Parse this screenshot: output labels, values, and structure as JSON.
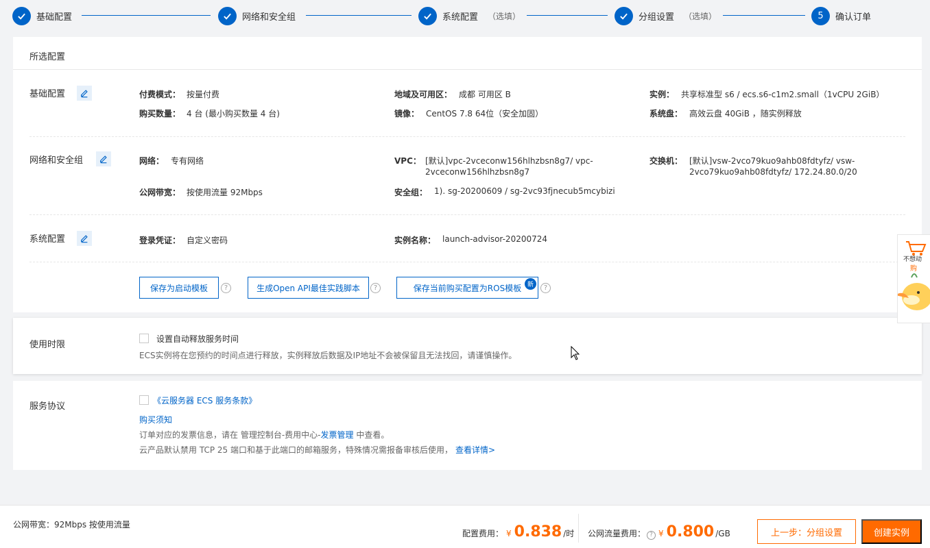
{
  "steps": [
    {
      "label": "基础配置",
      "optional": "",
      "done": true
    },
    {
      "label": "网络和安全组",
      "optional": "",
      "done": true
    },
    {
      "label": "系统配置",
      "optional": "（选填）",
      "done": true
    },
    {
      "label": "分组设置",
      "optional": "（选填）",
      "done": true
    },
    {
      "label": "确认订单",
      "optional": "",
      "done": false,
      "number": "5"
    }
  ],
  "selected": {
    "title": "所选配置",
    "basic": {
      "title": "基础配置",
      "billing_key": "付费模式：",
      "billing_val": "按量付费",
      "region_key": "地域及可用区：",
      "region_val": "成都 可用区 B",
      "instance_key": "实例：",
      "instance_val": "共享标准型 s6 / ecs.s6-c1m2.small（1vCPU 2GiB）",
      "qty_key": "购买数量：",
      "qty_val": "4 台 (最小购买数量 4 台)",
      "image_key": "镜像：",
      "image_val": "CentOS 7.8 64位（安全加固）",
      "disk_key": "系统盘：",
      "disk_val": "高效云盘 40GiB ，随实例释放"
    },
    "network": {
      "title": "网络和安全组",
      "net_key": "网络：",
      "net_val": "专有网络",
      "vpc_key": "VPC：",
      "vpc_val_1": "[默认]vpc-2vceconw156hlhzbsn8g7/ vpc-",
      "vpc_val_2": "2vceconw156hlhzbsn8g7",
      "switch_key": "交换机：",
      "switch_val_1": "[默认]vsw-2vco79kuo9ahb08fdtyfz/ vsw-",
      "switch_val_2": "2vco79kuo9ahb08fdtyfz/ 172.24.80.0/20",
      "bw_key": "公网带宽：",
      "bw_val": "按使用流量 92Mbps",
      "sg_key": "安全组：",
      "sg_val": "1). sg-20200609 / sg-2vc93fjnecub5mcybizi"
    },
    "system": {
      "title": "系统配置",
      "login_key": "登录凭证：",
      "login_val": "自定义密码",
      "name_key": "实例名称：",
      "name_val": "launch-advisor-20200724"
    },
    "buttons": {
      "save_template": "保存为启动模板",
      "gen_api": "生成Open API最佳实践脚本",
      "save_ros": "保存当前购买配置为ROS模板",
      "new_badge": "新",
      "help": "?"
    }
  },
  "usage": {
    "title": "使用时限",
    "checkbox_label": "设置自动释放服务时间",
    "note": "ECS实例将在您预约的时间点进行释放，实例释放后数据及IP地址不会被保留且无法找回，请谨慎操作。"
  },
  "agreement": {
    "title": "服务协议",
    "terms_link": "《云服务器 ECS 服务条款》",
    "notice_link": "购买须知",
    "line1_pre": "订单对应的发票信息，请在 管理控制台-费用中心-",
    "line1_link": "发票管理",
    "line1_post": " 中查看。",
    "line2": "云产品默认禁用 TCP 25 端口和基于此端口的邮箱服务，特殊情况需报备审核后使用，",
    "line2_link": "查看详情>"
  },
  "bottom": {
    "bandwidth_summary": "公网带宽：92Mbps 按使用流量",
    "config_fee_label": "配置费用：",
    "currency": "¥",
    "config_fee": "0.838",
    "config_unit": "/时",
    "traffic_fee_label": "公网流量费用：",
    "traffic_fee": "0.800",
    "traffic_unit": "/GB",
    "prev_button": "上一步：分组设置",
    "create_button": "创建实例"
  },
  "side_widget": {
    "text_1": "不想动",
    "text_2": "购"
  },
  "colors": {
    "primary": "#0064c8",
    "accent": "#ff6a00"
  }
}
